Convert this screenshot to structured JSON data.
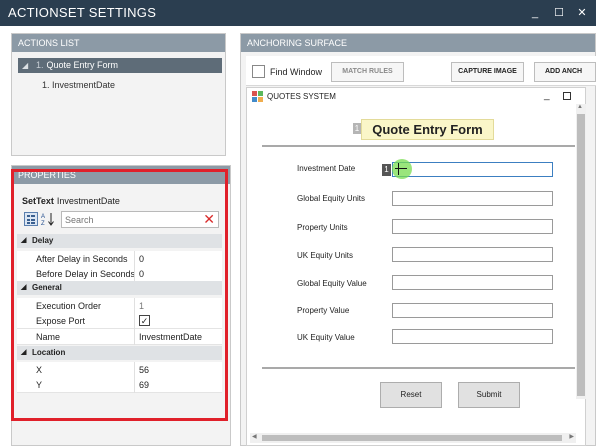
{
  "window": {
    "title": "ACTIONSET SETTINGS",
    "min_glyph": "_",
    "max_glyph": "☐",
    "close_glyph": "✕"
  },
  "actions_list": {
    "title": "ACTIONS LIST",
    "selected": {
      "number": "1.",
      "label": "Quote Entry Form"
    },
    "child": {
      "label": "1. InvestmentDate"
    }
  },
  "properties": {
    "title": "PROPERTIES",
    "action_type": "SetText",
    "action_target": "InvestmentDate",
    "search_placeholder": "Search",
    "categories": {
      "delay": {
        "label": "Delay",
        "rows": [
          {
            "key": "After Delay in Seconds",
            "value": "0"
          },
          {
            "key": "Before Delay in Seconds",
            "value": "0"
          }
        ]
      },
      "general": {
        "label": "General",
        "rows": [
          {
            "key": "Execution Order",
            "value": "1"
          },
          {
            "key": "Expose Port",
            "value": "✓"
          },
          {
            "key": "Name",
            "value": "InvestmentDate"
          }
        ]
      },
      "location": {
        "label": "Location",
        "rows": [
          {
            "key": "X",
            "value": "56"
          },
          {
            "key": "Y",
            "value": "69"
          }
        ]
      }
    }
  },
  "anchoring": {
    "title": "ANCHORING SURFACE",
    "find_window_label": "Find Window",
    "match_rules_label": "MATCH RULES",
    "capture_image_label": "CAPTURE IMAGE",
    "add_anchor_label": "ADD ANCH"
  },
  "quotes": {
    "window_title": "QUOTES SYSTEM",
    "heading_badge": "1",
    "heading": "Quote Entry Form",
    "field_badge": "1",
    "fields": [
      {
        "label": "Investment Date"
      },
      {
        "label": "Global Equity Units"
      },
      {
        "label": "Property Units"
      },
      {
        "label": "UK Equity Units"
      },
      {
        "label": "Global Equity Value"
      },
      {
        "label": "Property Value"
      },
      {
        "label": "UK Equity Value"
      }
    ],
    "reset_label": "Reset",
    "submit_label": "Submit"
  },
  "colors": {
    "titlebar": "#2b3e50",
    "panel_header": "#8c9aa6",
    "highlight": "#e0202a",
    "selected_row": "#5e6c78"
  }
}
